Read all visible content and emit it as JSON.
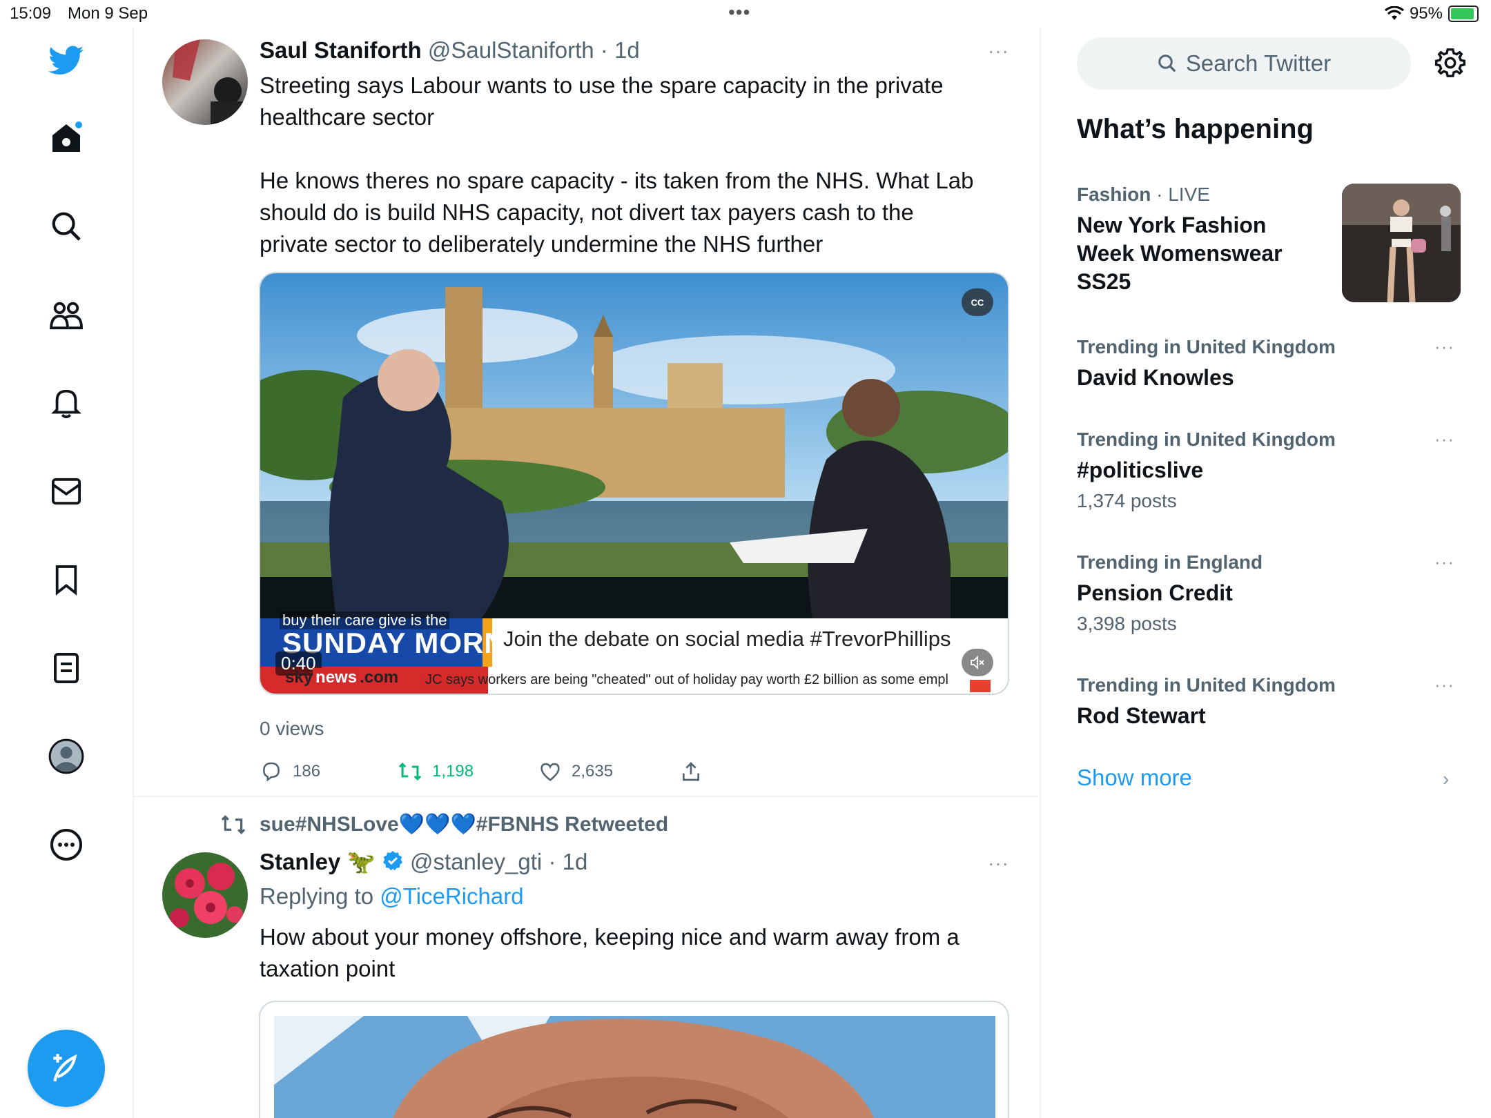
{
  "status_bar": {
    "time": "15:09",
    "date": "Mon 9 Sep",
    "battery": "95%",
    "battery_level": 0.95
  },
  "nav": {
    "items": [
      "twitter-logo",
      "home-icon",
      "search-icon",
      "communities-icon",
      "notifications-icon",
      "messages-icon",
      "bookmarks-icon",
      "lists-icon",
      "profile-icon",
      "more-icon"
    ],
    "compose": "compose-icon"
  },
  "tweet1": {
    "name": "Saul Staniforth",
    "handle": "@SaulStaniforth",
    "time": "· 1d",
    "more": "···",
    "text": "Streeting says Labour wants to use the spare capacity in the private\nhealthcare sector\n\nHe knows theres no spare capacity - its taken from the NHS. What Lab\nshould do is build NHS capacity, not divert tax payers cash to the\nprivate sector to deliberately undermine the NHS further",
    "video": {
      "caption": "buy their care give is the",
      "show": "SUNDAY MORNING",
      "duration": "0:40",
      "ticker_main": "Join the debate on social media #TrevorPhillips",
      "logo_sky": "sky",
      "logo_news": "news",
      "logo_com": ".com",
      "ticker_sub": "JC says workers are being \"cheated\" out of holiday pay worth £2 billion as some empl",
      "cc": "CC"
    },
    "views": "0 views",
    "replies": "186",
    "retweets": "1,198",
    "likes": "2,635"
  },
  "tweet2": {
    "retweeted_by": "sue#NHSLove💙💙💙#FBNHS Retweeted",
    "name": "Stanley 🦖",
    "handle": "@stanley_gti",
    "time": "· 1d",
    "more": "···",
    "replying_label": "Replying to",
    "replying_to": "@TiceRichard",
    "text": "How about your money offshore, keeping nice and warm away from a\ntaxation point"
  },
  "sidebar": {
    "search_placeholder": "Search Twitter",
    "heading": "What’s happening",
    "trends": [
      {
        "context": "Fashion",
        "live": "· LIVE",
        "title": "New York Fashion\nWeek Womenswear\nSS25"
      },
      {
        "context": "Trending in United Kingdom",
        "title": "David Knowles"
      },
      {
        "context": "Trending in United Kingdom",
        "title": "#politicslive",
        "count": "1,374 posts"
      },
      {
        "context": "Trending in England",
        "title": "Pension Credit",
        "count": "3,398 posts"
      },
      {
        "context": "Trending in United Kingdom",
        "title": "Rod Stewart"
      }
    ],
    "more": "···",
    "show_more": "Show more",
    "chevron": "›"
  },
  "colors": {
    "accent": "#1d9bf0",
    "retweet": "#00ba7c",
    "muted": "#536471"
  }
}
